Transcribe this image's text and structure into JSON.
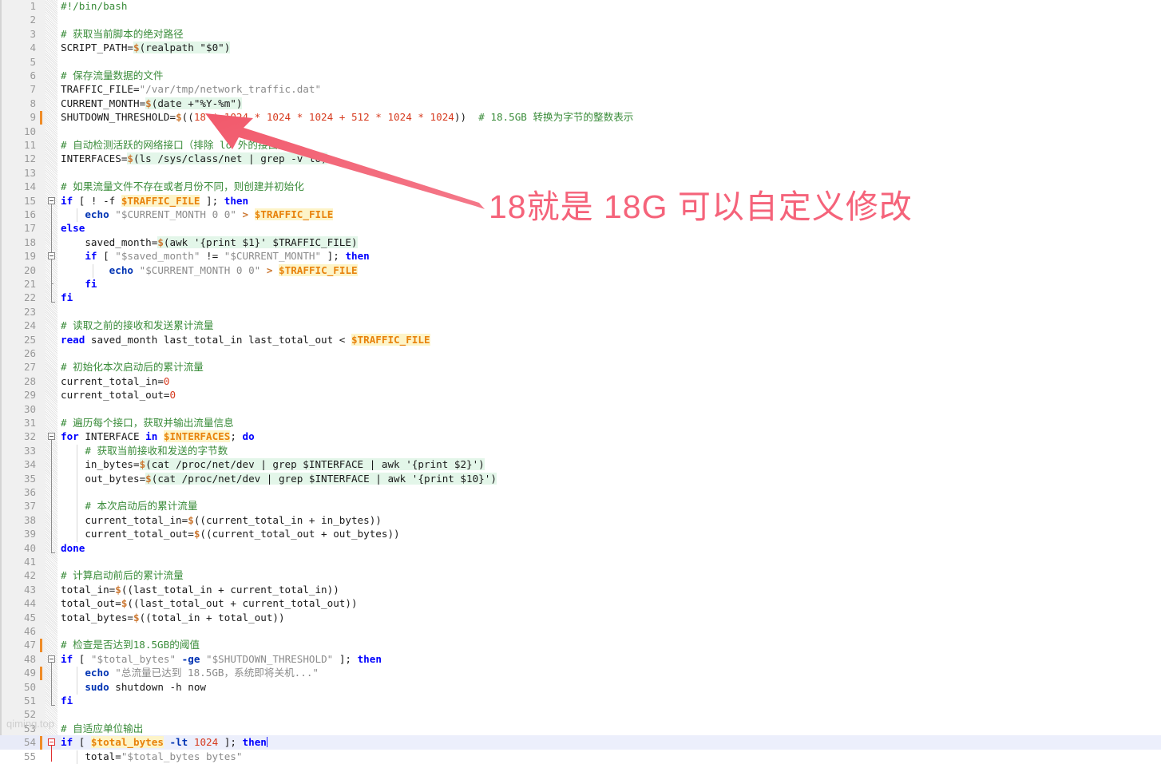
{
  "editor": {
    "language": "bash",
    "gutter_color": "#f0f0f0",
    "current_line": 54,
    "cursor_line_number": 54,
    "first_visible_line": 1,
    "last_visible_line": 55,
    "change_marker_color": "#ef8c28",
    "changed_lines": [
      9,
      47,
      49,
      54
    ],
    "lines": [
      {
        "n": 1,
        "html": "<span class=\"cmt\">#!/bin/bash</span>"
      },
      {
        "n": 2,
        "html": ""
      },
      {
        "n": 3,
        "html": "<span class=\"cmt\"># 获取当前脚本的绝对路径</span>"
      },
      {
        "n": 4,
        "html": "<span class=\"plain\">SCRIPT_PATH=</span><span class=\"subst\"><span class=\"dollar\">$</span><span class=\"plain\">(realpath \"$0\")</span></span>"
      },
      {
        "n": 5,
        "html": ""
      },
      {
        "n": 6,
        "html": "<span class=\"cmt\"># 保存流量数据的文件</span>"
      },
      {
        "n": 7,
        "html": "<span class=\"plain\">TRAFFIC_FILE=</span><span class=\"dim\">\"/var/tmp/network_traffic.dat\"</span>"
      },
      {
        "n": 8,
        "html": "<span class=\"plain\">CURRENT_MONTH=</span><span class=\"subst\"><span class=\"dollar\">$</span><span class=\"plain\">(date +\"%Y-%m\")</span></span>"
      },
      {
        "n": 9,
        "html": "<span class=\"plain\">SHUTDOWN_THRESHOLD=</span><span class=\"dollar\">$</span><span class=\"plain\">((</span><span class=\"num\">18 * 1024 * 1024 * 1024 + 512 * 1024 * 1024</span><span class=\"plain\">))</span><span class=\"plain\">  </span><span class=\"cmt\"># 18.5GB 转换为字节的整数表示</span>"
      },
      {
        "n": 10,
        "html": ""
      },
      {
        "n": 11,
        "html": "<span class=\"cmt\"># 自动检测活跃的网络接口（排除 lo 外的接口）</span>"
      },
      {
        "n": 12,
        "html": "<span class=\"plain\">INTERFACES=</span><span class=\"subst\"><span class=\"dollar\">$</span><span class=\"plain\">(ls /sys/class/net | grep -v lo)</span></span>"
      },
      {
        "n": 13,
        "html": ""
      },
      {
        "n": 14,
        "html": "<span class=\"cmt\"># 如果流量文件不存在或者月份不同，则创建并初始化</span>"
      },
      {
        "n": 15,
        "html": "<span class=\"kw\">if</span><span class=\"plain\"> [ ! -f </span><span class=\"varhl\">$TRAFFIC_FILE</span><span class=\"plain\"> ]; </span><span class=\"kw\">then</span>"
      },
      {
        "n": 16,
        "html": "<span class=\"plain\">    </span><span class=\"kw2\">echo</span><span class=\"plain\"> </span><span class=\"dim\">\"$CURRENT_MONTH 0 0\"</span><span class=\"plain\"> </span><span class=\"dollar\">&gt;</span><span class=\"plain\"> </span><span class=\"varhl\">$TRAFFIC_FILE</span>"
      },
      {
        "n": 17,
        "html": "<span class=\"kw\">else</span>"
      },
      {
        "n": 18,
        "html": "<span class=\"plain\">    saved_month=</span><span class=\"subst\"><span class=\"dollar\">$</span><span class=\"plain\">(awk '{print $1}' $TRAFFIC_FILE)</span></span>"
      },
      {
        "n": 19,
        "html": "<span class=\"plain\">    </span><span class=\"kw\">if</span><span class=\"plain\"> [ </span><span class=\"dim\">\"$saved_month\"</span><span class=\"plain\"> != </span><span class=\"dim\">\"$CURRENT_MONTH\"</span><span class=\"plain\"> ]; </span><span class=\"kw\">then</span>"
      },
      {
        "n": 20,
        "html": "<span class=\"plain\">        </span><span class=\"kw2\">echo</span><span class=\"plain\"> </span><span class=\"dim\">\"$CURRENT_MONTH 0 0\"</span><span class=\"plain\"> </span><span class=\"dollar\">&gt;</span><span class=\"plain\"> </span><span class=\"varhl\">$TRAFFIC_FILE</span>"
      },
      {
        "n": 21,
        "html": "<span class=\"plain\">    </span><span class=\"kw\">fi</span>"
      },
      {
        "n": 22,
        "html": "<span class=\"kw\">fi</span>"
      },
      {
        "n": 23,
        "html": ""
      },
      {
        "n": 24,
        "html": "<span class=\"cmt\"># 读取之前的接收和发送累计流量</span>"
      },
      {
        "n": 25,
        "html": "<span class=\"kw\">read</span><span class=\"plain\"> saved_month last_total_in last_total_out &lt; </span><span class=\"varhl\">$TRAFFIC_FILE</span>"
      },
      {
        "n": 26,
        "html": ""
      },
      {
        "n": 27,
        "html": "<span class=\"cmt\"># 初始化本次启动后的累计流量</span>"
      },
      {
        "n": 28,
        "html": "<span class=\"plain\">current_total_in=</span><span class=\"num\">0</span>"
      },
      {
        "n": 29,
        "html": "<span class=\"plain\">current_total_out=</span><span class=\"num\">0</span>"
      },
      {
        "n": 30,
        "html": ""
      },
      {
        "n": 31,
        "html": "<span class=\"cmt\"># 遍历每个接口，获取并输出流量信息</span>"
      },
      {
        "n": 32,
        "html": "<span class=\"kw\">for</span><span class=\"plain\"> INTERFACE </span><span class=\"kw\">in</span><span class=\"plain\"> </span><span class=\"varhl\">$INTERFACES</span><span class=\"plain\">; </span><span class=\"kw\">do</span>"
      },
      {
        "n": 33,
        "html": "<span class=\"plain\">    </span><span class=\"cmt\"># 获取当前接收和发送的字节数</span>"
      },
      {
        "n": 34,
        "html": "<span class=\"plain\">    in_bytes=</span><span class=\"subst\"><span class=\"dollar\">$</span><span class=\"plain\">(cat /proc/net/dev | grep $INTERFACE | awk '{print $2}')</span></span>"
      },
      {
        "n": 35,
        "html": "<span class=\"plain\">    out_bytes=</span><span class=\"subst\"><span class=\"dollar\">$</span><span class=\"plain\">(cat /proc/net/dev | grep $INTERFACE | awk '{print $10}')</span></span>"
      },
      {
        "n": 36,
        "html": ""
      },
      {
        "n": 37,
        "html": "<span class=\"plain\">    </span><span class=\"cmt\"># 本次启动后的累计流量</span>"
      },
      {
        "n": 38,
        "html": "<span class=\"plain\">    current_total_in=</span><span class=\"dollar\">$</span><span class=\"plain\">((current_total_in + in_bytes))</span>"
      },
      {
        "n": 39,
        "html": "<span class=\"plain\">    current_total_out=</span><span class=\"dollar\">$</span><span class=\"plain\">((current_total_out + out_bytes))</span>"
      },
      {
        "n": 40,
        "html": "<span class=\"kw\">done</span>"
      },
      {
        "n": 41,
        "html": ""
      },
      {
        "n": 42,
        "html": "<span class=\"cmt\"># 计算启动前后的累计流量</span>"
      },
      {
        "n": 43,
        "html": "<span class=\"plain\">total_in=</span><span class=\"dollar\">$</span><span class=\"plain\">((last_total_in + current_total_in))</span>"
      },
      {
        "n": 44,
        "html": "<span class=\"plain\">total_out=</span><span class=\"dollar\">$</span><span class=\"plain\">((last_total_out + current_total_out))</span>"
      },
      {
        "n": 45,
        "html": "<span class=\"plain\">total_bytes=</span><span class=\"dollar\">$</span><span class=\"plain\">((total_in + total_out))</span>"
      },
      {
        "n": 46,
        "html": ""
      },
      {
        "n": 47,
        "html": "<span class=\"cmt\"># 检查是否达到18.5GB的阈值</span>"
      },
      {
        "n": 48,
        "html": "<span class=\"kw\">if</span><span class=\"plain\"> [ </span><span class=\"dim\">\"$total_bytes\"</span><span class=\"plain\"> </span><span class=\"kw2\">-ge</span><span class=\"plain\"> </span><span class=\"dim\">\"$SHUTDOWN_THRESHOLD\"</span><span class=\"plain\"> ]; </span><span class=\"kw\">then</span>"
      },
      {
        "n": 49,
        "html": "<span class=\"plain\">    </span><span class=\"kw2\">echo</span><span class=\"plain\"> </span><span class=\"dim\">\"总流量已达到 18.5GB，系统即将关机...\"</span>"
      },
      {
        "n": 50,
        "html": "<span class=\"plain\">    </span><span class=\"kw2\">sudo</span><span class=\"plain\"> shutdown -h now</span>"
      },
      {
        "n": 51,
        "html": "<span class=\"kw\">fi</span>"
      },
      {
        "n": 52,
        "html": ""
      },
      {
        "n": 53,
        "html": "<span class=\"cmt\"># 自适应单位输出</span>"
      },
      {
        "n": 54,
        "html": "<span class=\"kw\">if</span><span class=\"plain\"> [ </span><span class=\"varhl\">$total_bytes</span><span class=\"plain\"> </span><span class=\"kw2\">-lt</span><span class=\"plain\"> </span><span class=\"num\">1024</span><span class=\"plain\"> ]; </span><span class=\"kw\">then</span>"
      },
      {
        "n": 55,
        "html": "<span class=\"plain\">    total=</span><span class=\"dim\">\"$total_bytes bytes\"</span>"
      }
    ]
  },
  "annotation": {
    "text": "18就是 18G 可以自定义修改",
    "color": "#f5637a",
    "arrow_color": "#ef5f6e",
    "arrow_points_to": "18",
    "arrow_target_line": 9
  },
  "watermark": {
    "text": "qiming.top"
  }
}
